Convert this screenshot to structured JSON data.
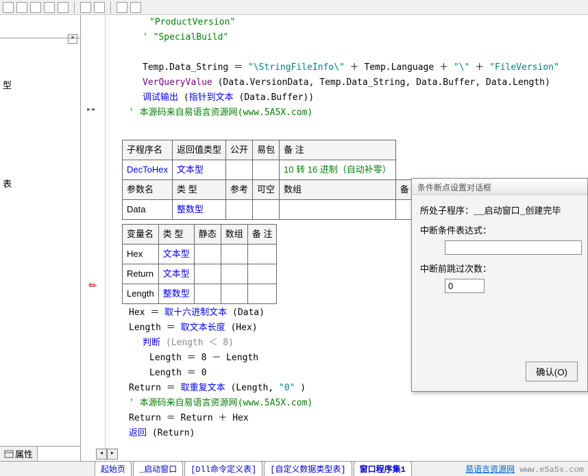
{
  "toolbar": {
    "icons": [
      "a",
      "b",
      "c",
      "d",
      "e",
      "sep",
      "f",
      "g",
      "sep",
      "h",
      "i"
    ]
  },
  "left": {
    "close": "×",
    "label1": "型",
    "label2": "表",
    "prop_tab": "属性"
  },
  "code": {
    "l1": "\"ProductVersion\"",
    "l2": "' \"SpecialBuild\"",
    "l4a": "Temp.Data_String ",
    "eq": "＝",
    "l4b": " \"\\StringFileInfo\\\" ",
    "plus": "＋",
    "l4c": " Temp.Language ",
    "l4d": " \"\\\" ",
    "l4e": " \"FileVersion\"",
    "l5a": "VerQueryValue",
    "l5b": " (Data.VersionData, Temp.Data_String, Data.Buffer, Data.Length)",
    "l6a": "调试输出",
    "l6b": " (",
    "l6c": "指针到文本",
    "l6d": " (Data.Buffer))",
    "l7": "' 本源码来自易语言资源网(www.5A5X.com)",
    "table1": {
      "h": [
        "子程序名",
        "返回值类型",
        "公开",
        "易包",
        "备 注"
      ],
      "r1": [
        "DecToHex",
        "文本型",
        "",
        "",
        "10 转 16 进制（自动补零）"
      ],
      "h2": [
        "参数名",
        "类 型",
        "参考",
        "可空",
        "数组",
        "备 注"
      ],
      "r2": [
        "Data",
        "整数型",
        "",
        "",
        "",
        ""
      ]
    },
    "table2": {
      "h": [
        "变量名",
        "类 型",
        "静态",
        "数组",
        "备 注"
      ],
      "r1": [
        "Hex",
        "文本型",
        "",
        "",
        ""
      ],
      "r2": [
        "Return",
        "文本型",
        "",
        "",
        ""
      ],
      "r3": [
        "Length",
        "整数型",
        "",
        "",
        ""
      ]
    },
    "b1a": "Hex ",
    "b1b": "取十六进制文本",
    "b1c": " (Data)",
    "b2a": "Length ",
    "b2b": "取文本长度",
    "b2c": " (Hex)",
    "b3a": "判断",
    "b3b": " (Length ＜ 8)",
    "b4": "Length ＝ 8 － Length",
    "b5": "Length ＝ 0",
    "b6a": "Return ",
    "b6b": "取重复文本",
    "b6c": " (Length, ",
    "b6d": "\"0\"",
    "b6e": " )",
    "b7": "' 本源码来自易语言资源网(www.5A5X.com)",
    "b8": "Return ＝ Return ＋ Hex",
    "b9a": "返回",
    "b9b": " (Return)"
  },
  "tabs": {
    "t1": "起始页",
    "t2": "_启动窗口",
    "t3": "[Dll命令定义表]",
    "t4": "[自定义数据类型表]",
    "t5": "窗口程序集1"
  },
  "watermark": {
    "site": "易语言资源网",
    "url": "www.e5a5x.com"
  },
  "dialog": {
    "title": "条件断点设置对话框",
    "proc_label": "所处子程序：",
    "proc_value": "__启动窗口_创建完毕",
    "cond_label": "中断条件表达式：",
    "cond_value": "",
    "skip_label": "中断前跳过次数：",
    "skip_value": "0",
    "ok": "确认(O)"
  }
}
